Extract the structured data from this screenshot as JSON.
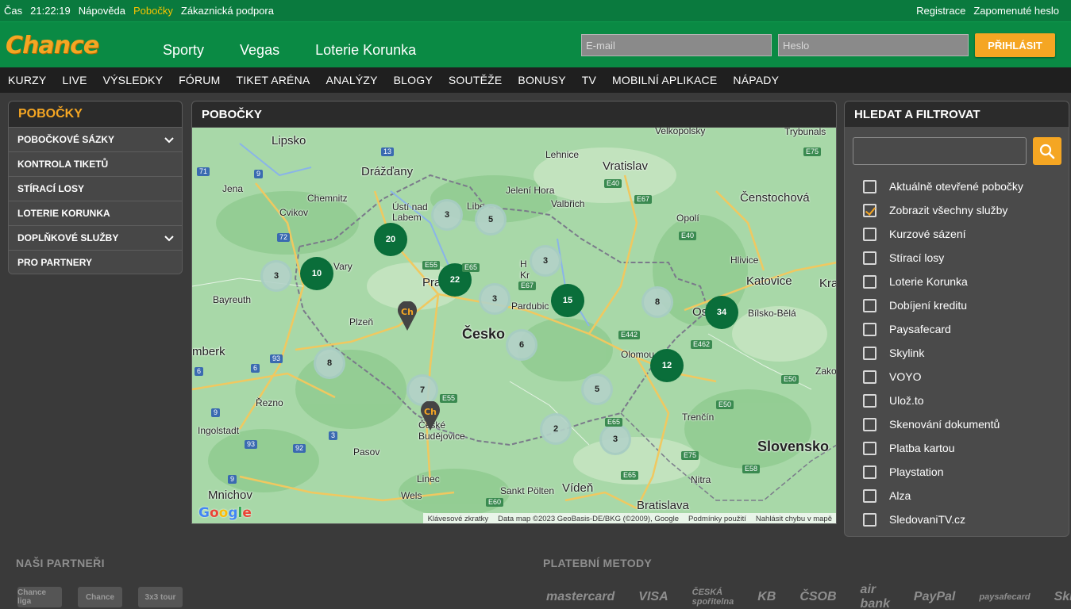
{
  "topbar": {
    "time_label": "Čas",
    "time_value": "21:22:19",
    "links": [
      "Nápověda",
      "Pobočky",
      "Zákaznická podpora"
    ],
    "active_link": "Pobočky",
    "right_links": [
      "Registrace",
      "Zapomenuté heslo"
    ]
  },
  "header": {
    "logo_text": "Chance",
    "nav": [
      "Sporty",
      "Vegas",
      "Loterie Korunka"
    ],
    "email_placeholder": "E-mail",
    "password_placeholder": "Heslo",
    "login_label": "PŘIHLÁSIT"
  },
  "subnav": [
    "KURZY",
    "LIVE",
    "VÝSLEDKY",
    "FÓRUM",
    "TIKET ARÉNA",
    "ANALÝZY",
    "BLOGY",
    "SOUTĚŽE",
    "BONUSY",
    "TV",
    "MOBILNÍ APLIKACE",
    "NÁPADY"
  ],
  "sidebar": {
    "title": "POBOČKY",
    "items": [
      {
        "label": "POBOČKOVÉ SÁZKY",
        "expandable": true
      },
      {
        "label": "KONTROLA TIKETŮ",
        "expandable": false
      },
      {
        "label": "STÍRACÍ LOSY",
        "expandable": false
      },
      {
        "label": "LOTERIE KORUNKA",
        "expandable": false
      },
      {
        "label": "DOPLŇKOVÉ SLUŽBY",
        "expandable": true
      },
      {
        "label": "PRO PARTNERY",
        "expandable": false
      }
    ]
  },
  "map": {
    "title": "POBOČKY",
    "cities": [
      {
        "name": "Lipsko",
        "size": "big"
      },
      {
        "name": "Drážďany",
        "size": "big"
      },
      {
        "name": "Vratislav",
        "size": "big"
      },
      {
        "name": "Velkopolsky",
        "size": ""
      },
      {
        "name": "Trybunals",
        "size": ""
      },
      {
        "name": "Lehnice",
        "size": ""
      },
      {
        "name": "Jena",
        "size": ""
      },
      {
        "name": "Chemnitz",
        "size": ""
      },
      {
        "name": "Jelení Hora",
        "size": ""
      },
      {
        "name": "Valbřich",
        "size": ""
      },
      {
        "name": "Čenstochová",
        "size": "big"
      },
      {
        "name": "Cvikov",
        "size": ""
      },
      {
        "name": "Ústí nad Labem",
        "size": ""
      },
      {
        "name": "Libe",
        "size": ""
      },
      {
        "name": "Opolí",
        "size": ""
      },
      {
        "name": "Hlivice",
        "size": ""
      },
      {
        "name": "Katovice",
        "size": "big"
      },
      {
        "name": "Krak",
        "size": "big"
      },
      {
        "name": "Vary",
        "size": ""
      },
      {
        "name": "Pra",
        "size": "big"
      },
      {
        "name": "H Kr",
        "size": ""
      },
      {
        "name": "Bayreuth",
        "size": ""
      },
      {
        "name": "Pardubic",
        "size": ""
      },
      {
        "name": "Os",
        "size": "big"
      },
      {
        "name": "Bílsko-Bělá",
        "size": ""
      },
      {
        "name": "Plzeň",
        "size": ""
      },
      {
        "name": "Česko",
        "size": "xl"
      },
      {
        "name": "mberk",
        "size": "big"
      },
      {
        "name": "Olomou",
        "size": ""
      },
      {
        "name": "Zako",
        "size": ""
      },
      {
        "name": "Řezno",
        "size": ""
      },
      {
        "name": "Ingolstadt",
        "size": ""
      },
      {
        "name": "České Budějovice",
        "size": ""
      },
      {
        "name": "Trenčín",
        "size": ""
      },
      {
        "name": "Slovensko",
        "size": "xl"
      },
      {
        "name": "Pasov",
        "size": ""
      },
      {
        "name": "Mnichov",
        "size": "big"
      },
      {
        "name": "Linec",
        "size": ""
      },
      {
        "name": "Wels",
        "size": ""
      },
      {
        "name": "Sankt Pölten",
        "size": ""
      },
      {
        "name": "Vídeň",
        "size": "big"
      },
      {
        "name": "Bratislava",
        "size": "big"
      },
      {
        "name": "Nitra",
        "size": ""
      }
    ],
    "clusters": [
      {
        "count": "3",
        "style": "light"
      },
      {
        "count": "5",
        "style": "light"
      },
      {
        "count": "20",
        "style": "dark"
      },
      {
        "count": "3",
        "style": "light"
      },
      {
        "count": "10",
        "style": "dark"
      },
      {
        "count": "22",
        "style": "dark"
      },
      {
        "count": "3",
        "style": "light"
      },
      {
        "count": "3",
        "style": "light"
      },
      {
        "count": "15",
        "style": "dark"
      },
      {
        "count": "8",
        "style": "light"
      },
      {
        "count": "34",
        "style": "dark"
      },
      {
        "count": "6",
        "style": "light"
      },
      {
        "count": "8",
        "style": "light"
      },
      {
        "count": "12",
        "style": "dark"
      },
      {
        "count": "7",
        "style": "light"
      },
      {
        "count": "5",
        "style": "light"
      },
      {
        "count": "2",
        "style": "light"
      },
      {
        "count": "3",
        "style": "light"
      }
    ],
    "pin_label": "Ch",
    "road_labels": [
      "13",
      "71",
      "9",
      "72",
      "E55",
      "E65",
      "E67",
      "E40",
      "E67",
      "E75",
      "E40",
      "E442",
      "E462",
      "E50",
      "E55",
      "E65",
      "E75",
      "E58",
      "E60",
      "E65",
      "93",
      "6",
      "6",
      "9",
      "3",
      "92",
      "93",
      "9",
      "E50"
    ],
    "footer": [
      "Klávesové zkratky",
      "Data map ©2023 GeoBasis-DE/BKG (©2009), Google",
      "Podmínky použití",
      "Nahlásit chybu v mapě"
    ],
    "google_text": "Google"
  },
  "filters": {
    "title": "HLEDAT A FILTROVAT",
    "options": [
      {
        "label": "Aktuálně otevřené pobočky",
        "checked": false
      },
      {
        "label": "Zobrazit všechny služby",
        "checked": true
      },
      {
        "label": "Kurzové sázení",
        "checked": false
      },
      {
        "label": "Stírací losy",
        "checked": false
      },
      {
        "label": "Loterie Korunka",
        "checked": false
      },
      {
        "label": "Dobíjení kreditu",
        "checked": false
      },
      {
        "label": "Paysafecard",
        "checked": false
      },
      {
        "label": "Skylink",
        "checked": false
      },
      {
        "label": "VOYO",
        "checked": false
      },
      {
        "label": "Ulož.to",
        "checked": false
      },
      {
        "label": "Skenování dokumentů",
        "checked": false
      },
      {
        "label": "Platba kartou",
        "checked": false
      },
      {
        "label": "Playstation",
        "checked": false
      },
      {
        "label": "Alza",
        "checked": false
      },
      {
        "label": "SledovaniTV.cz",
        "checked": false
      }
    ]
  },
  "footer": {
    "partners_title": "NAŠI PARTNEŘI",
    "partners": [
      "Chance liga",
      "Chance",
      "3x3 tour"
    ],
    "payments_title": "PLATEBNÍ METODY",
    "payments": [
      "mastercard",
      "VISA",
      "ČESKÁ spořitelna",
      "KB",
      "ČSOB",
      "air bank",
      "PayPal",
      "paysafecard",
      "Skrill"
    ]
  },
  "colors": {
    "brand_green": "#0a8a44",
    "accent_orange": "#f5a623",
    "cluster_dark": "#0a6e3a"
  }
}
